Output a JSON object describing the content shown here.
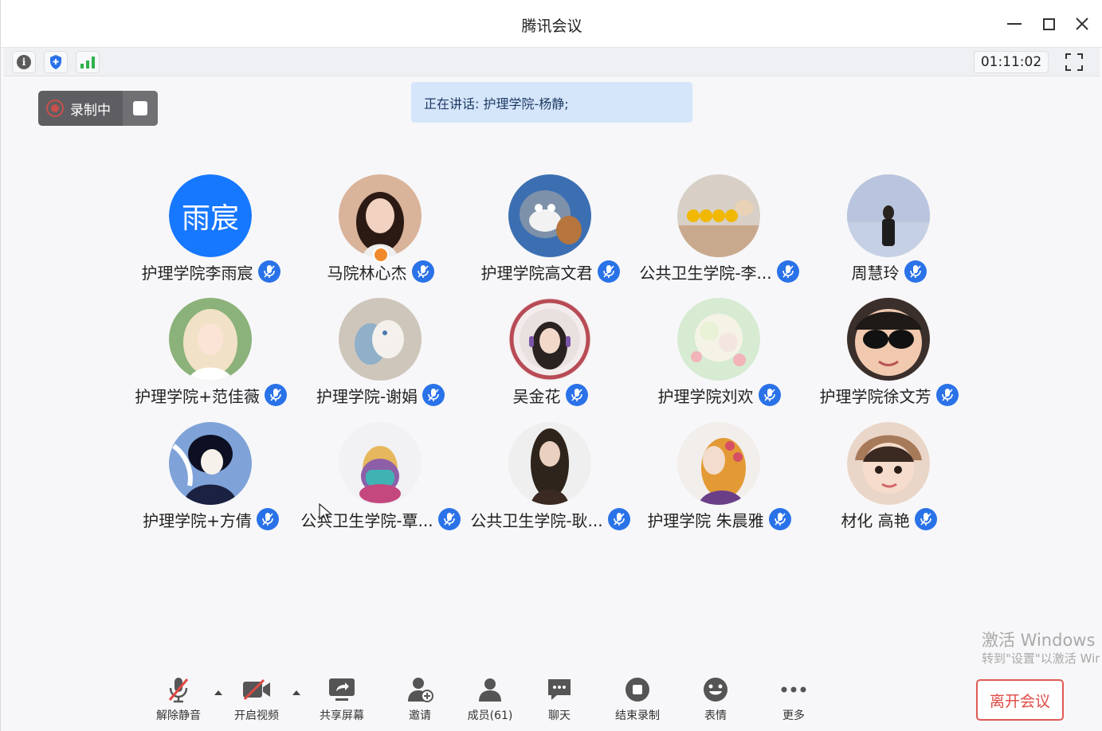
{
  "window": {
    "title": "腾讯会议",
    "timer": "01:11:02"
  },
  "toolbar": {
    "icons": [
      "info-icon",
      "shield-icon",
      "signal-icon"
    ]
  },
  "recording": {
    "label": "录制中"
  },
  "speaking": {
    "text": "正在讲话: 护理学院-杨静;"
  },
  "participants": [
    {
      "name": "护理学院李雨宸",
      "avatar_text": "雨宸"
    },
    {
      "name": "马院林心杰",
      "avatar_text": ""
    },
    {
      "name": "护理学院高文君",
      "avatar_text": ""
    },
    {
      "name": "公共卫生学院-李...",
      "avatar_text": ""
    },
    {
      "name": "周慧玲",
      "avatar_text": ""
    },
    {
      "name": "护理学院+范佳薇",
      "avatar_text": ""
    },
    {
      "name": "护理学院-谢娟",
      "avatar_text": ""
    },
    {
      "name": "吴金花",
      "avatar_text": ""
    },
    {
      "name": "护理学院刘欢",
      "avatar_text": ""
    },
    {
      "name": "护理学院徐文芳",
      "avatar_text": ""
    },
    {
      "name": "护理学院+方倩",
      "avatar_text": ""
    },
    {
      "name": "公共卫生学院-覃...",
      "avatar_text": ""
    },
    {
      "name": "公共卫生学院-耿...",
      "avatar_text": ""
    },
    {
      "name": "护理学院 朱晨雅",
      "avatar_text": ""
    },
    {
      "name": "材化 高艳",
      "avatar_text": ""
    }
  ],
  "bottombar": {
    "unmute": "解除静音",
    "video": "开启视频",
    "share": "共享屏幕",
    "invite": "邀请",
    "members": "成员(61)",
    "chat": "聊天",
    "end_record": "结束录制",
    "emoji": "表情",
    "more": "更多",
    "leave": "离开会议"
  },
  "watermark": {
    "line1": "激活 Windows",
    "line2": "转到\"设置\"以激活 Wir"
  },
  "colors": {
    "accent": "#2a72e8",
    "leave": "#e04a44",
    "speaking_bg": "#d5e6fb"
  }
}
